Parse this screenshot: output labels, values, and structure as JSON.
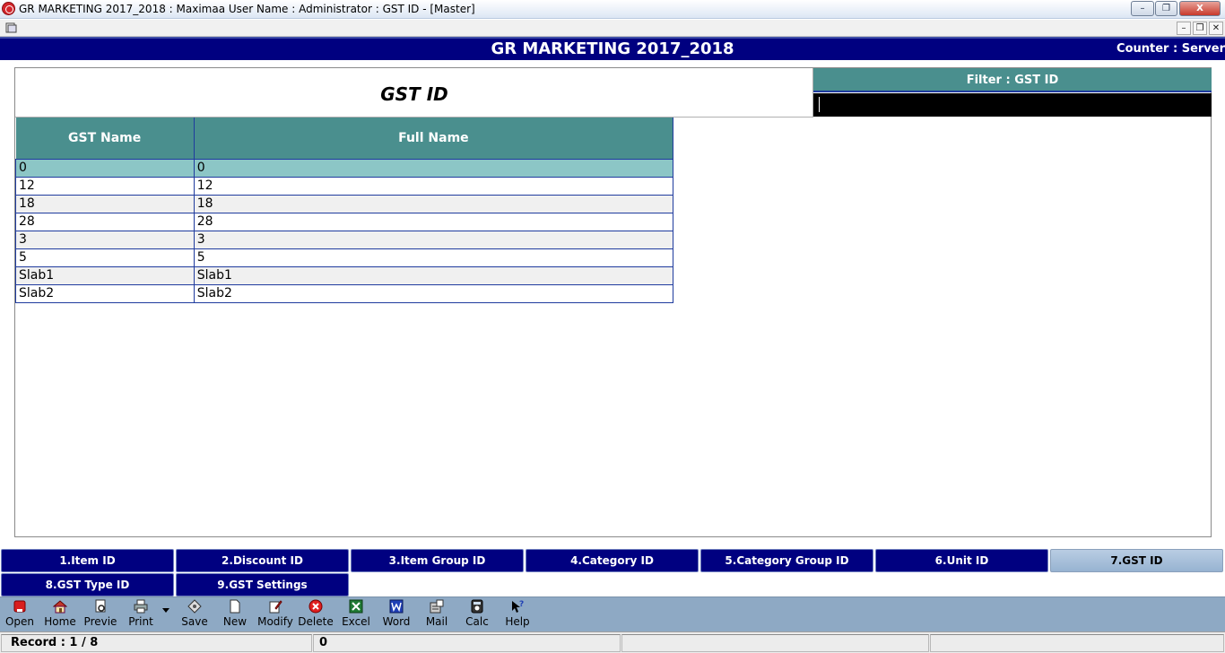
{
  "window": {
    "title": "GR MARKETING 2017_2018 : Maximaa User Name : Administrator : GST ID  - [Master]",
    "minimize": "–",
    "restore": "❐",
    "close": "X"
  },
  "mdi": {
    "minimize": "–",
    "restore": "❐",
    "close": "✕"
  },
  "header": {
    "company": "GR MARKETING 2017_2018",
    "counter": "Counter : Server"
  },
  "page": {
    "title": "GST ID"
  },
  "filter": {
    "label": "Filter : GST ID",
    "value": ""
  },
  "grid": {
    "columns": [
      "GST Name",
      "Full Name"
    ],
    "rows": [
      [
        "0",
        "0"
      ],
      [
        "12",
        "12"
      ],
      [
        "18",
        "18"
      ],
      [
        "28",
        "28"
      ],
      [
        "3",
        "3"
      ],
      [
        "5",
        "5"
      ],
      [
        "Slab1",
        "Slab1"
      ],
      [
        "Slab2",
        "Slab2"
      ]
    ],
    "selected_row": 0
  },
  "tabs": [
    "1.Item ID",
    "2.Discount ID",
    "3.Item Group ID",
    "4.Category ID",
    "5.Category Group ID",
    "6.Unit ID",
    "7.GST ID",
    "8.GST Type ID",
    "9.GST Settings"
  ],
  "active_tab": "7.GST ID",
  "toolbar": [
    {
      "label": "Open",
      "icon": "open-icon"
    },
    {
      "label": "Home",
      "icon": "home-icon"
    },
    {
      "label": "Previe",
      "icon": "preview-icon"
    },
    {
      "label": "Print",
      "icon": "print-icon"
    },
    {
      "label": "Save",
      "icon": "save-icon"
    },
    {
      "label": "New",
      "icon": "new-icon"
    },
    {
      "label": "Modify",
      "icon": "modify-icon"
    },
    {
      "label": "Delete",
      "icon": "delete-icon"
    },
    {
      "label": "Excel",
      "icon": "excel-icon"
    },
    {
      "label": "Word",
      "icon": "word-icon"
    },
    {
      "label": "Mail",
      "icon": "mail-icon"
    },
    {
      "label": "Calc",
      "icon": "calc-icon"
    },
    {
      "label": "Help",
      "icon": "help-icon"
    }
  ],
  "status": {
    "record": "Record : 1 / 8",
    "value": "0"
  }
}
